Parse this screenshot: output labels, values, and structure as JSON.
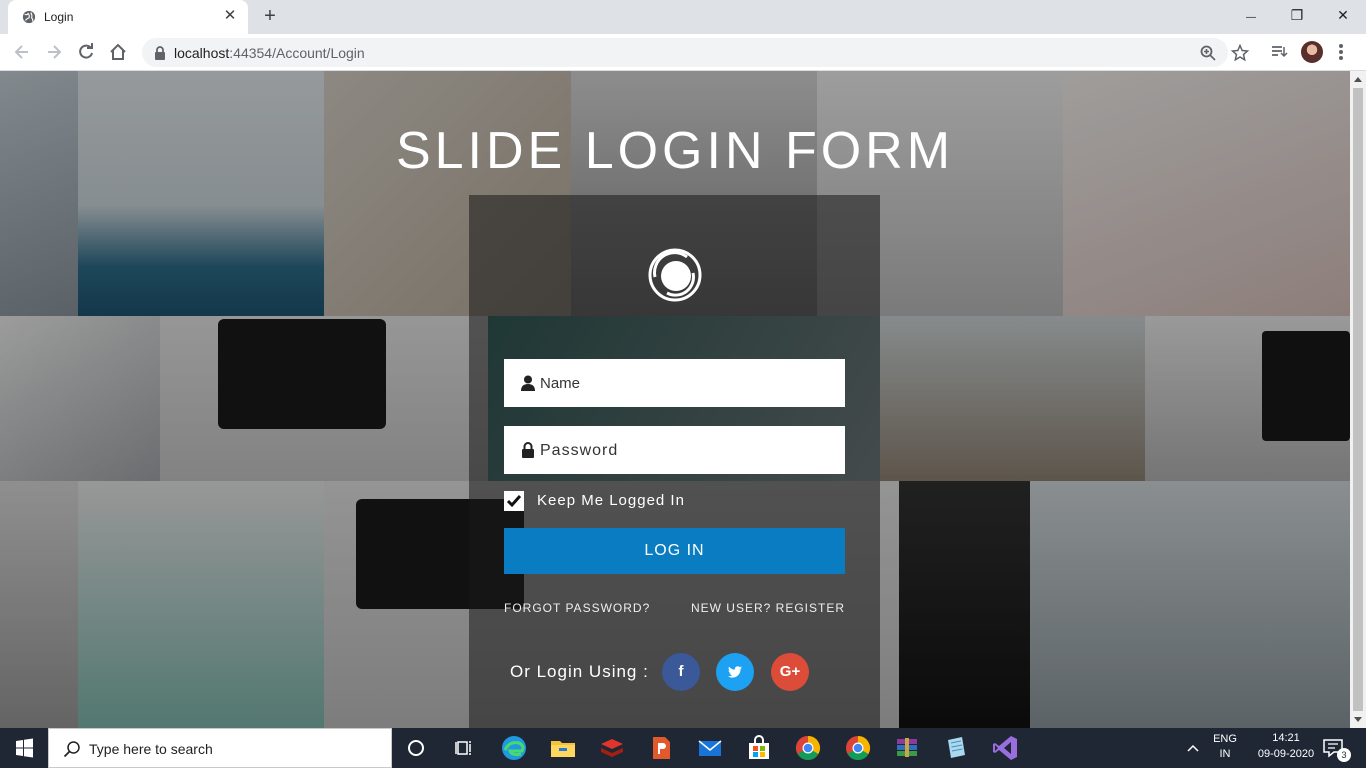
{
  "browser": {
    "tab_title": "Login",
    "url_host": "localhost",
    "url_rest": ":44354/Account/Login",
    "new_tab_label": "+",
    "minimize_label": "—",
    "restore_label": "❐",
    "close_label": "✕"
  },
  "page": {
    "title": "SLIDE LOGIN FORM",
    "name_placeholder": "Name",
    "password_placeholder": "Password",
    "remember_label": "Keep Me Logged In",
    "remember_checked": true,
    "login_label": "LOG IN",
    "forgot_label": "FORGOT PASSWORD?",
    "register_label": "NEW USER? REGISTER",
    "social_label": "Or Login Using :",
    "social": {
      "facebook": "f",
      "twitter": "t",
      "google": "G+"
    },
    "colors": {
      "login_button": "#0a7cc1",
      "facebook": "#3b5998",
      "twitter": "#1da1f2",
      "google": "#dd4b39"
    }
  },
  "taskbar": {
    "search_placeholder": "Type here to search",
    "lang_top": "ENG",
    "lang_bottom": "IN",
    "time": "14:21",
    "date": "09-09-2020",
    "notifications": "3"
  }
}
